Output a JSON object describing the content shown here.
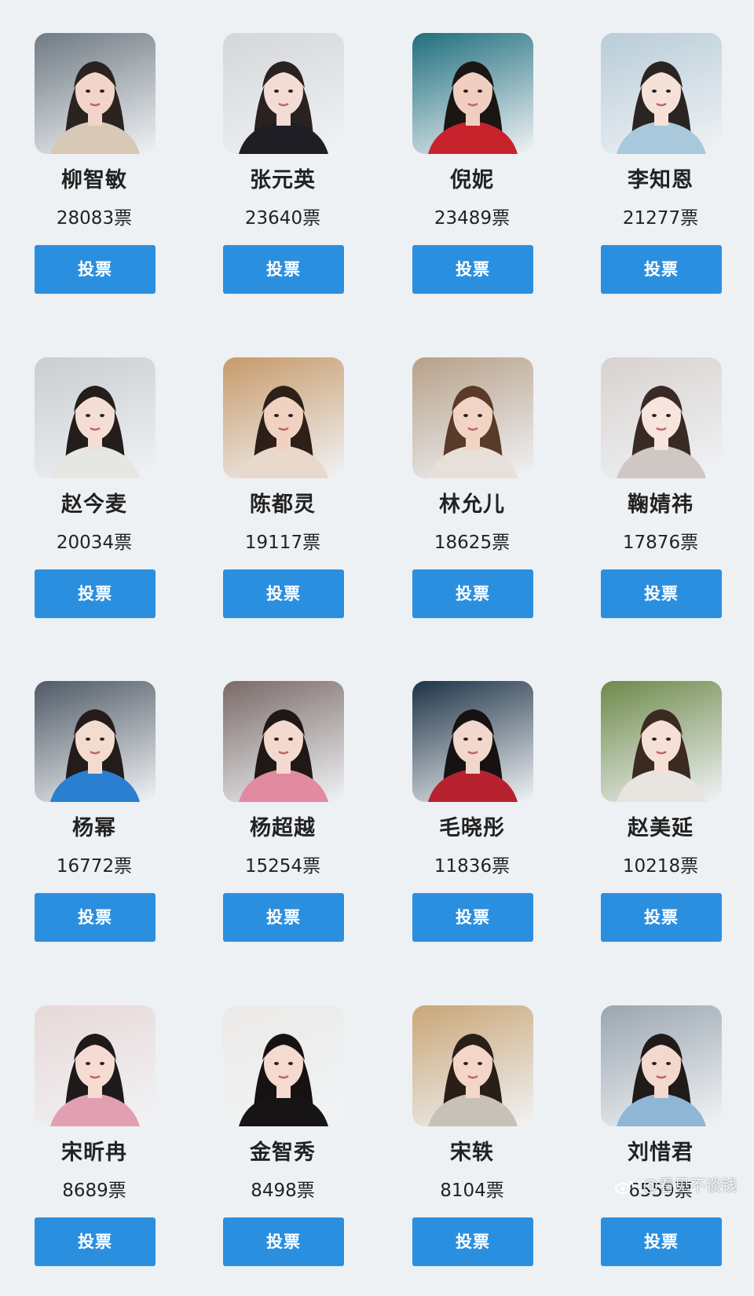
{
  "vote_button_label": "投票",
  "watermark": "@看见不谈钱",
  "contestants": [
    {
      "name": "柳智敏",
      "votes": "28083票",
      "bg": "#6f7a83",
      "hair": "#2b2320",
      "skin": "#f2d5c8",
      "outfit": "#d8c8b6"
    },
    {
      "name": "张元英",
      "votes": "23640票",
      "bg": "#d4d6d8",
      "hair": "#2a2220",
      "skin": "#f3dcd3",
      "outfit": "#1e1e24"
    },
    {
      "name": "倪妮",
      "votes": "23489票",
      "bg": "#1f6f7e",
      "hair": "#1b1614",
      "skin": "#f0cfc0",
      "outfit": "#c8232c"
    },
    {
      "name": "李知恩",
      "votes": "21277票",
      "bg": "#b8ccd8",
      "hair": "#2a2422",
      "skin": "#f6e1d8",
      "outfit": "#aac8dc"
    },
    {
      "name": "赵今麦",
      "votes": "20034票",
      "bg": "#c9cdd0",
      "hair": "#231d1b",
      "skin": "#f4ded4",
      "outfit": "#e6e6e2"
    },
    {
      "name": "陈都灵",
      "votes": "19117票",
      "bg": "#c79a6a",
      "hair": "#2e2018",
      "skin": "#f1d2c0",
      "outfit": "#e9d9cc"
    },
    {
      "name": "林允儿",
      "votes": "18625票",
      "bg": "#b7a089",
      "hair": "#5a3a28",
      "skin": "#f1d4c4",
      "outfit": "#e8e0d8"
    },
    {
      "name": "鞠婧祎",
      "votes": "17876票",
      "bg": "#d8d2cf",
      "hair": "#3a2a26",
      "skin": "#f7e4dc",
      "outfit": "#cfc7c3"
    },
    {
      "name": "杨幂",
      "votes": "16772票",
      "bg": "#505a66",
      "hair": "#241c1a",
      "skin": "#f3dbd0",
      "outfit": "#2a7fd0"
    },
    {
      "name": "杨超越",
      "votes": "15254票",
      "bg": "#7a6a68",
      "hair": "#201816",
      "skin": "#f4d9cf",
      "outfit": "#e18aa0"
    },
    {
      "name": "毛晓彤",
      "votes": "11836票",
      "bg": "#1e3346",
      "hair": "#161212",
      "skin": "#f2d7cc",
      "outfit": "#b82230"
    },
    {
      "name": "赵美延",
      "votes": "10218票",
      "bg": "#6e8a4a",
      "hair": "#3a2a22",
      "skin": "#f6e0d6",
      "outfit": "#e8e4e0"
    },
    {
      "name": "宋昕冉",
      "votes": "8689票",
      "bg": "#e8d8d8",
      "hair": "#1f1a1a",
      "skin": "#f5dbd2",
      "outfit": "#e39fb2"
    },
    {
      "name": "金智秀",
      "votes": "8498票",
      "bg": "#eceae8",
      "hair": "#161212",
      "skin": "#f4dacf",
      "outfit": "#161414"
    },
    {
      "name": "宋轶",
      "votes": "8104票",
      "bg": "#c9a676",
      "hair": "#2a1e18",
      "skin": "#f3d6c8",
      "outfit": "#c7c1b8"
    },
    {
      "name": "刘惜君",
      "votes": "6559票",
      "bg": "#9aa6b0",
      "hair": "#201a18",
      "skin": "#f2d8cd",
      "outfit": "#8fb6d4"
    }
  ]
}
